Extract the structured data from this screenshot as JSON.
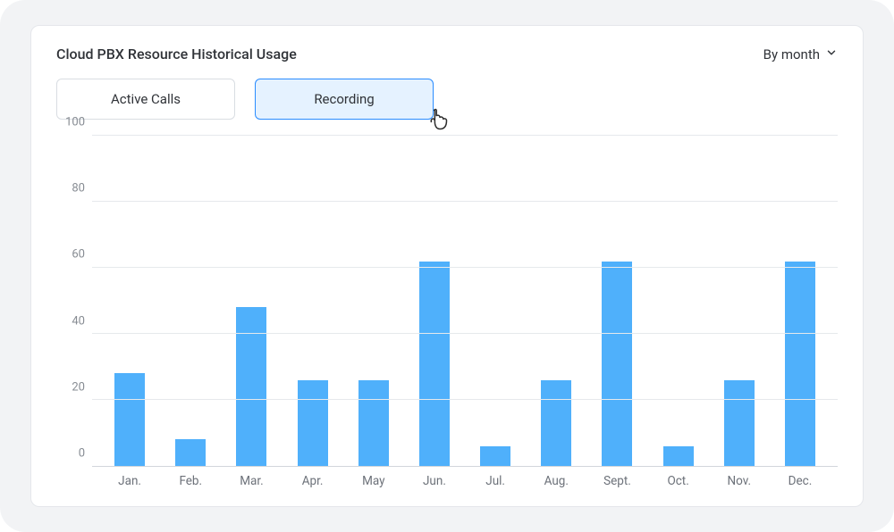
{
  "header": {
    "title": "Cloud PBX Resource Historical Usage",
    "dropdown_label": "By month"
  },
  "tabs": {
    "active_calls": "Active Calls",
    "recording": "Recording",
    "active_index": 1
  },
  "chart_data": {
    "type": "bar",
    "title": "Cloud PBX Resource Historical Usage",
    "xlabel": "",
    "ylabel": "",
    "ylim": [
      0,
      100
    ],
    "y_ticks": [
      0,
      20,
      40,
      60,
      80,
      100
    ],
    "categories": [
      "Jan.",
      "Feb.",
      "Mar.",
      "Apr.",
      "May",
      "Jun.",
      "Jul.",
      "Aug.",
      "Sept.",
      "Oct.",
      "Nov.",
      "Dec."
    ],
    "values": [
      28,
      8,
      48,
      26,
      26,
      62,
      6,
      26,
      62,
      6,
      26,
      62
    ],
    "series_name": "Recording",
    "bar_color": "#4fb0fb"
  }
}
